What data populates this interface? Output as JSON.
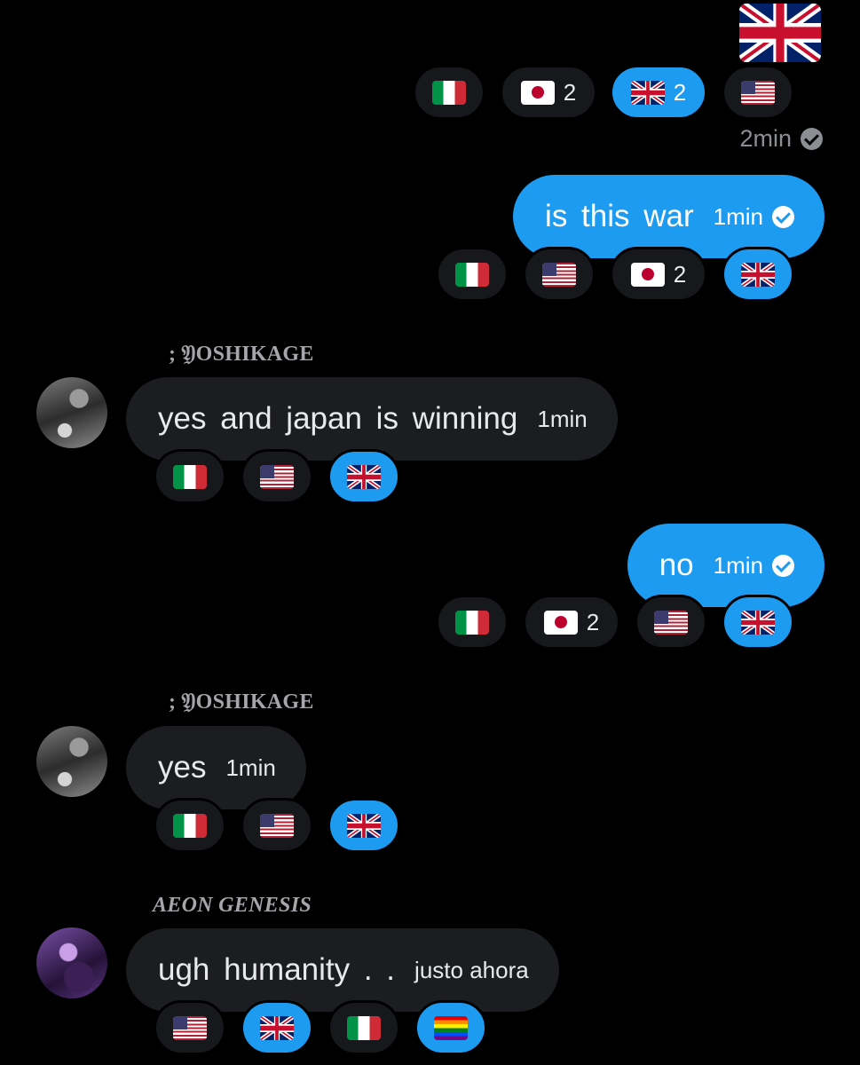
{
  "top_sticker": {
    "icon": "flag-gb-icon"
  },
  "top_reactions": [
    {
      "flag": "it",
      "count": ""
    },
    {
      "flag": "jp",
      "count": "2"
    },
    {
      "flag": "gb",
      "count": "2",
      "selected": true
    },
    {
      "flag": "us",
      "count": ""
    }
  ],
  "top_meta": {
    "time": "2min"
  },
  "messages": [
    {
      "direction": "out",
      "text": "is this war",
      "time": "1min",
      "reactions": [
        {
          "flag": "it",
          "count": ""
        },
        {
          "flag": "us",
          "count": ""
        },
        {
          "flag": "jp",
          "count": "2"
        },
        {
          "flag": "gb",
          "count": "",
          "selected": true
        }
      ]
    },
    {
      "direction": "in",
      "sender": "; 𝔜OSHIKAGE",
      "text": "yes and japan is winning",
      "time": "1min",
      "reactions": [
        {
          "flag": "it",
          "count": ""
        },
        {
          "flag": "us",
          "count": ""
        },
        {
          "flag": "gb",
          "count": "",
          "selected": true
        }
      ]
    },
    {
      "direction": "out",
      "text": "no",
      "time": "1min",
      "reactions": [
        {
          "flag": "it",
          "count": ""
        },
        {
          "flag": "jp",
          "count": "2"
        },
        {
          "flag": "us",
          "count": ""
        },
        {
          "flag": "gb",
          "count": "",
          "selected": true
        }
      ]
    },
    {
      "direction": "in",
      "sender": "; 𝔜OSHIKAGE",
      "text": "yes",
      "time": "1min",
      "reactions": [
        {
          "flag": "it",
          "count": ""
        },
        {
          "flag": "us",
          "count": ""
        },
        {
          "flag": "gb",
          "count": "",
          "selected": true
        }
      ]
    },
    {
      "direction": "in",
      "sender": "AEON GENESIS",
      "text": "ugh  humanity . .",
      "time": "justo ahora",
      "reactions": [
        {
          "flag": "us",
          "count": ""
        },
        {
          "flag": "gb",
          "count": "",
          "selected": true
        },
        {
          "flag": "it",
          "count": ""
        },
        {
          "flag": "rainbow",
          "count": "",
          "selected": true
        }
      ]
    }
  ],
  "colors": {
    "accent": "#1d9bf0",
    "incoming_bubble": "#1c1d20",
    "background": "#000000"
  }
}
